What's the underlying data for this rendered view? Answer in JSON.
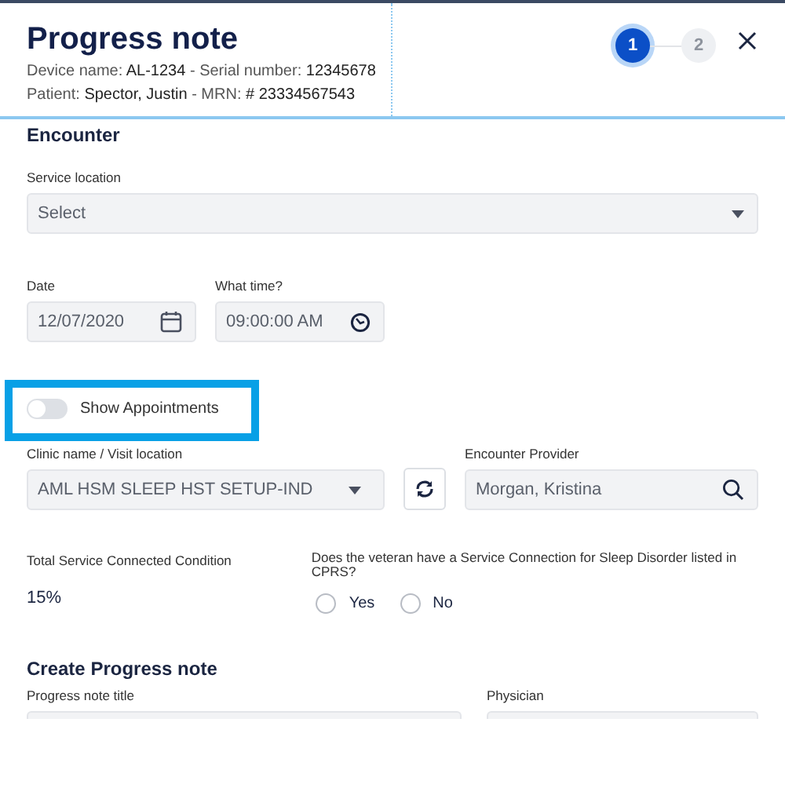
{
  "header": {
    "title": "Progress note",
    "device_line": "Device name: **AL-1234** - Serial number: **12345678**",
    "patient_line": "Patient: **Spector, Justin** -  MRN: **# 23334567543**"
  },
  "steps": [
    {
      "label": "1",
      "selected": true
    },
    {
      "label": "2",
      "selected": false
    }
  ],
  "encounter": {
    "heading": "Encounter",
    "service_location": {
      "label": "Service location",
      "placeholder": "Select"
    },
    "date": {
      "label": "Date",
      "value": "12/07/2020"
    },
    "time": {
      "label": "What time?",
      "value": "09:00:00 AM"
    },
    "show_appointments": {
      "label": "Show Appointments",
      "on": false,
      "highlighted": true
    },
    "clinic": {
      "label": "Clinic name / Visit location",
      "value": "AML HSM SLEEP HST SETUP-IND"
    },
    "provider": {
      "label": "Encounter Provider",
      "value": "Morgan, Kristina"
    },
    "service_condition": {
      "label": "Total Service  Connected Condition",
      "value": "15%"
    },
    "question": {
      "label": "Does the veteran have a Service Connection for Sleep Disorder listed in CPRS?",
      "options": [
        {
          "label": "Yes",
          "selected": false
        },
        {
          "label": "No",
          "selected": false
        }
      ]
    }
  },
  "create": {
    "heading": "Create Progress note",
    "title_label": "Progress note title",
    "physician_label": "Physician"
  }
}
